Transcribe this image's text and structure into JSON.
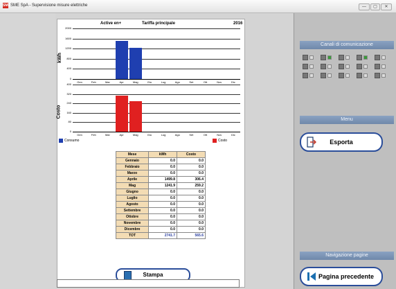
{
  "window": {
    "title": "SME SpA - Supervisione misure elettriche",
    "app_icon": "SME",
    "minimize": "—",
    "maximize": "▢",
    "close": "✕"
  },
  "report": {
    "header_mode": "Active  en+",
    "header_tariff": "Tariffa principale",
    "header_year": "2016",
    "kwh_label": "kWh",
    "cost_label": "Costo",
    "kwh_ticks": [
      "2000",
      "1600",
      "1200",
      "800",
      "400",
      "0"
    ],
    "cost_ticks": [
      "400",
      "320",
      "240",
      "160",
      "80",
      "0"
    ],
    "month_ticks": [
      "Gen",
      "Feb",
      "Mar",
      "Apr",
      "Mag",
      "Giu",
      "Lug",
      "Ago",
      "Set",
      "Ott",
      "Nov",
      "Dic"
    ],
    "legend_consumo": "Consumo",
    "legend_costo": "Costo",
    "table_headers": [
      "Mese",
      "kWh",
      "Costo"
    ],
    "rows": [
      [
        "Gennaio",
        "0.0",
        "0.0"
      ],
      [
        "Febbraio",
        "0.0",
        "0.0"
      ],
      [
        "Marzo",
        "0.0",
        "0.0"
      ],
      [
        "Aprile",
        "1499.8",
        "306.4"
      ],
      [
        "Mag",
        "1241.9",
        "259.2"
      ],
      [
        "Giugno",
        "0.0",
        "0.0"
      ],
      [
        "Luglio",
        "0.0",
        "0.0"
      ],
      [
        "Agosto",
        "0.0",
        "0.0"
      ],
      [
        "Settembre",
        "0.0",
        "0.0"
      ],
      [
        "Ottobre",
        "0.0",
        "0.0"
      ],
      [
        "Novembre",
        "0.0",
        "0.0"
      ],
      [
        "Dicembre",
        "0.0",
        "0.0"
      ]
    ],
    "total": [
      "TOT",
      "2741.7",
      "565.6"
    ],
    "print_label": "Stampa"
  },
  "chart_data": [
    {
      "type": "bar",
      "categories": [
        "Gen",
        "Feb",
        "Mar",
        "Apr",
        "Mag",
        "Giu",
        "Lug",
        "Ago",
        "Set",
        "Ott",
        "Nov",
        "Dic"
      ],
      "series": [
        {
          "name": "Consumo",
          "values": [
            0,
            0,
            0,
            1499.8,
            1241.9,
            0,
            0,
            0,
            0,
            0,
            0,
            0
          ]
        }
      ],
      "ylabel": "kWh",
      "ylim": [
        0,
        2000
      ],
      "color": "#1f3fb0"
    },
    {
      "type": "bar",
      "categories": [
        "Gen",
        "Feb",
        "Mar",
        "Apr",
        "Mag",
        "Giu",
        "Lug",
        "Ago",
        "Set",
        "Ott",
        "Nov",
        "Dic"
      ],
      "series": [
        {
          "name": "Costo",
          "values": [
            0,
            0,
            0,
            306.4,
            259.2,
            0,
            0,
            0,
            0,
            0,
            0,
            0
          ]
        }
      ],
      "ylabel": "Costo",
      "ylim": [
        0,
        400
      ],
      "color": "#e02020"
    }
  ],
  "sidebar": {
    "channels_title": "Canali di comunicazione",
    "menu_title": "Menu",
    "export_label": "Esporta",
    "nav_title": "Navigazione pagine",
    "back_label": "Pagina precedente"
  },
  "colors": {
    "accent": "#2a4d9a",
    "header": "#7890b4",
    "kwh_bar": "#1f3fb0",
    "cost_bar": "#e02020",
    "table_label": "#f3dcb4",
    "channel_active": "#3a9a3a"
  }
}
